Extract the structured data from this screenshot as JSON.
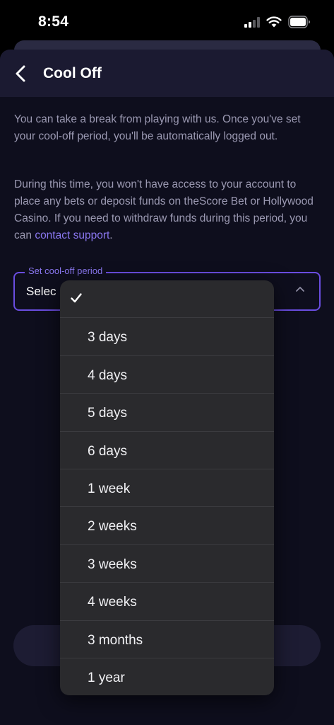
{
  "status_bar": {
    "time": "8:54"
  },
  "header": {
    "title": "Cool Off"
  },
  "content": {
    "intro": "You can take a break from playing with us. Once you've set your cool-off period, you'll be automatically logged out.",
    "detail": "During this time, you won't have access to your account to place any bets or deposit funds on theScore Bet or Hollywood Casino. If you need to withdraw funds during this period, you can ",
    "support_link": "contact support",
    "detail_end": "."
  },
  "select": {
    "label": "Set cool-off period",
    "value": "Selec"
  },
  "dropdown": {
    "selected_index": 0,
    "options": [
      "",
      "3 days",
      "4 days",
      "5 days",
      "6 days",
      "1 week",
      "2 weeks",
      "3 weeks",
      "4 weeks",
      "3 months",
      "1 year"
    ]
  },
  "colors": {
    "accent": "#6a4de0",
    "link": "#8a77f0",
    "background": "#0e0e1d",
    "menu": "#2a2a2d"
  }
}
